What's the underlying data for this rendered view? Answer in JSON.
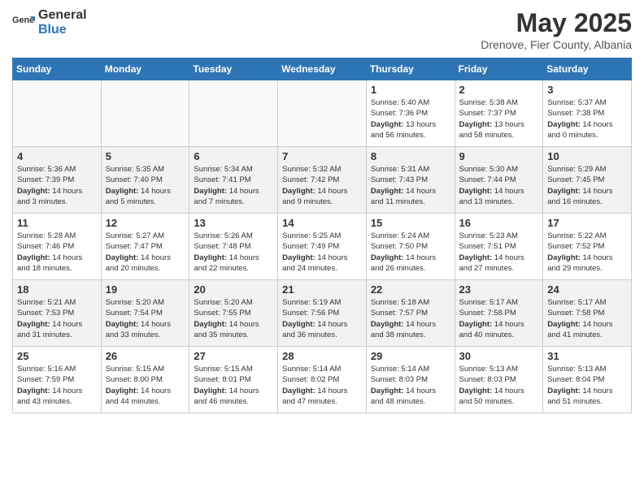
{
  "header": {
    "logo_general": "General",
    "logo_blue": "Blue",
    "month_title": "May 2025",
    "subtitle": "Drenove, Fier County, Albania"
  },
  "weekdays": [
    "Sunday",
    "Monday",
    "Tuesday",
    "Wednesday",
    "Thursday",
    "Friday",
    "Saturday"
  ],
  "weeks": [
    [
      {
        "day": "",
        "sunrise": "",
        "sunset": "",
        "daylight": "",
        "empty": true
      },
      {
        "day": "",
        "sunrise": "",
        "sunset": "",
        "daylight": "",
        "empty": true
      },
      {
        "day": "",
        "sunrise": "",
        "sunset": "",
        "daylight": "",
        "empty": true
      },
      {
        "day": "",
        "sunrise": "",
        "sunset": "",
        "daylight": "",
        "empty": true
      },
      {
        "day": "1",
        "sunrise": "5:40 AM",
        "sunset": "7:36 PM",
        "daylight": "13 hours and 56 minutes."
      },
      {
        "day": "2",
        "sunrise": "5:38 AM",
        "sunset": "7:37 PM",
        "daylight": "13 hours and 58 minutes."
      },
      {
        "day": "3",
        "sunrise": "5:37 AM",
        "sunset": "7:38 PM",
        "daylight": "14 hours and 0 minutes."
      }
    ],
    [
      {
        "day": "4",
        "sunrise": "5:36 AM",
        "sunset": "7:39 PM",
        "daylight": "14 hours and 3 minutes."
      },
      {
        "day": "5",
        "sunrise": "5:35 AM",
        "sunset": "7:40 PM",
        "daylight": "14 hours and 5 minutes."
      },
      {
        "day": "6",
        "sunrise": "5:34 AM",
        "sunset": "7:41 PM",
        "daylight": "14 hours and 7 minutes."
      },
      {
        "day": "7",
        "sunrise": "5:32 AM",
        "sunset": "7:42 PM",
        "daylight": "14 hours and 9 minutes."
      },
      {
        "day": "8",
        "sunrise": "5:31 AM",
        "sunset": "7:43 PM",
        "daylight": "14 hours and 11 minutes."
      },
      {
        "day": "9",
        "sunrise": "5:30 AM",
        "sunset": "7:44 PM",
        "daylight": "14 hours and 13 minutes."
      },
      {
        "day": "10",
        "sunrise": "5:29 AM",
        "sunset": "7:45 PM",
        "daylight": "14 hours and 16 minutes."
      }
    ],
    [
      {
        "day": "11",
        "sunrise": "5:28 AM",
        "sunset": "7:46 PM",
        "daylight": "14 hours and 18 minutes."
      },
      {
        "day": "12",
        "sunrise": "5:27 AM",
        "sunset": "7:47 PM",
        "daylight": "14 hours and 20 minutes."
      },
      {
        "day": "13",
        "sunrise": "5:26 AM",
        "sunset": "7:48 PM",
        "daylight": "14 hours and 22 minutes."
      },
      {
        "day": "14",
        "sunrise": "5:25 AM",
        "sunset": "7:49 PM",
        "daylight": "14 hours and 24 minutes."
      },
      {
        "day": "15",
        "sunrise": "5:24 AM",
        "sunset": "7:50 PM",
        "daylight": "14 hours and 26 minutes."
      },
      {
        "day": "16",
        "sunrise": "5:23 AM",
        "sunset": "7:51 PM",
        "daylight": "14 hours and 27 minutes."
      },
      {
        "day": "17",
        "sunrise": "5:22 AM",
        "sunset": "7:52 PM",
        "daylight": "14 hours and 29 minutes."
      }
    ],
    [
      {
        "day": "18",
        "sunrise": "5:21 AM",
        "sunset": "7:53 PM",
        "daylight": "14 hours and 31 minutes."
      },
      {
        "day": "19",
        "sunrise": "5:20 AM",
        "sunset": "7:54 PM",
        "daylight": "14 hours and 33 minutes."
      },
      {
        "day": "20",
        "sunrise": "5:20 AM",
        "sunset": "7:55 PM",
        "daylight": "14 hours and 35 minutes."
      },
      {
        "day": "21",
        "sunrise": "5:19 AM",
        "sunset": "7:56 PM",
        "daylight": "14 hours and 36 minutes."
      },
      {
        "day": "22",
        "sunrise": "5:18 AM",
        "sunset": "7:57 PM",
        "daylight": "14 hours and 38 minutes."
      },
      {
        "day": "23",
        "sunrise": "5:17 AM",
        "sunset": "7:58 PM",
        "daylight": "14 hours and 40 minutes."
      },
      {
        "day": "24",
        "sunrise": "5:17 AM",
        "sunset": "7:58 PM",
        "daylight": "14 hours and 41 minutes."
      }
    ],
    [
      {
        "day": "25",
        "sunrise": "5:16 AM",
        "sunset": "7:59 PM",
        "daylight": "14 hours and 43 minutes."
      },
      {
        "day": "26",
        "sunrise": "5:15 AM",
        "sunset": "8:00 PM",
        "daylight": "14 hours and 44 minutes."
      },
      {
        "day": "27",
        "sunrise": "5:15 AM",
        "sunset": "8:01 PM",
        "daylight": "14 hours and 46 minutes."
      },
      {
        "day": "28",
        "sunrise": "5:14 AM",
        "sunset": "8:02 PM",
        "daylight": "14 hours and 47 minutes."
      },
      {
        "day": "29",
        "sunrise": "5:14 AM",
        "sunset": "8:03 PM",
        "daylight": "14 hours and 48 minutes."
      },
      {
        "day": "30",
        "sunrise": "5:13 AM",
        "sunset": "8:03 PM",
        "daylight": "14 hours and 50 minutes."
      },
      {
        "day": "31",
        "sunrise": "5:13 AM",
        "sunset": "8:04 PM",
        "daylight": "14 hours and 51 minutes."
      }
    ]
  ],
  "labels": {
    "sunrise_prefix": "Sunrise: ",
    "sunset_prefix": "Sunset: ",
    "daylight_label": "Daylight: "
  }
}
